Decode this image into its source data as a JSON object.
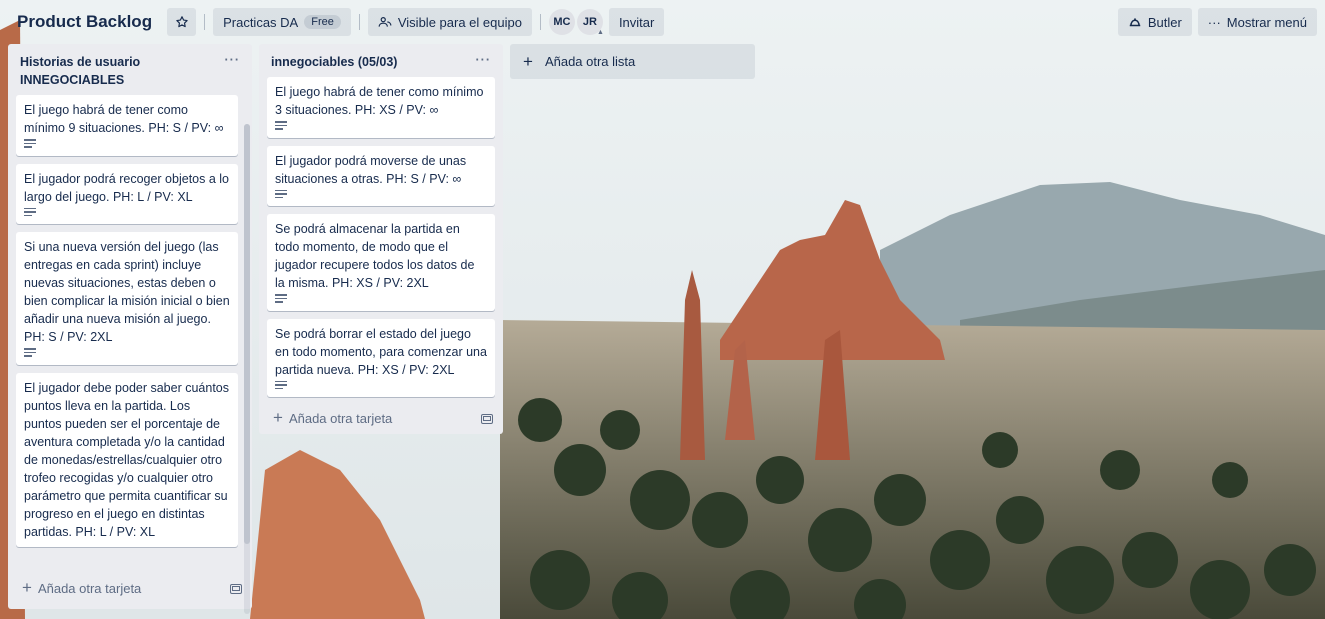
{
  "header": {
    "board_title": "Product Backlog",
    "workspace_label": "Practicas DA",
    "workspace_badge": "Free",
    "visibility_label": "Visible para el equipo",
    "members": [
      "MC",
      "JR"
    ],
    "invite_label": "Invitar",
    "butler_label": "Butler",
    "menu_label": "Mostrar menú"
  },
  "lists": [
    {
      "title": "Historias de usuario INNEGOCIABLES",
      "menu": "···",
      "cards": [
        "El juego habrá de tener como mínimo 9 situaciones. PH: S / PV: ∞",
        "El jugador podrá recoger objetos a lo largo del juego. PH: L / PV: XL",
        "Si una nueva versión del juego (las entregas en cada sprint) incluye nuevas situaciones, estas deben o bien complicar la misión inicial o bien añadir una nueva misión al juego. PH: S / PV: 2XL",
        "El jugador debe poder saber cuántos puntos lleva en la partida. Los puntos pueden ser el porcentaje de aventura completada y/o la cantidad de monedas/estrellas/cualquier otro trofeo recogidas y/o cualquier otro parámetro que permita cuantificar su progreso en el juego en distintas partidas. PH: L / PV: XL"
      ],
      "add_card_label": "Añada otra tarjeta"
    },
    {
      "title": "innegociables (05/03)",
      "menu": "···",
      "cards": [
        "El juego habrá de tener como mínimo 3 situaciones. PH: XS / PV: ∞",
        "El jugador podrá moverse de unas situaciones a otras. PH: S / PV: ∞",
        "Se podrá almacenar la partida en todo momento, de modo que el jugador recupere todos los datos de la misma. PH: XS / PV: 2XL",
        "Se podrá borrar el estado del juego en todo momento, para comenzar una partida nueva. PH: XS / PV: 2XL"
      ],
      "add_card_label": "Añada otra tarjeta"
    }
  ],
  "add_list_label": "Añada otra lista"
}
